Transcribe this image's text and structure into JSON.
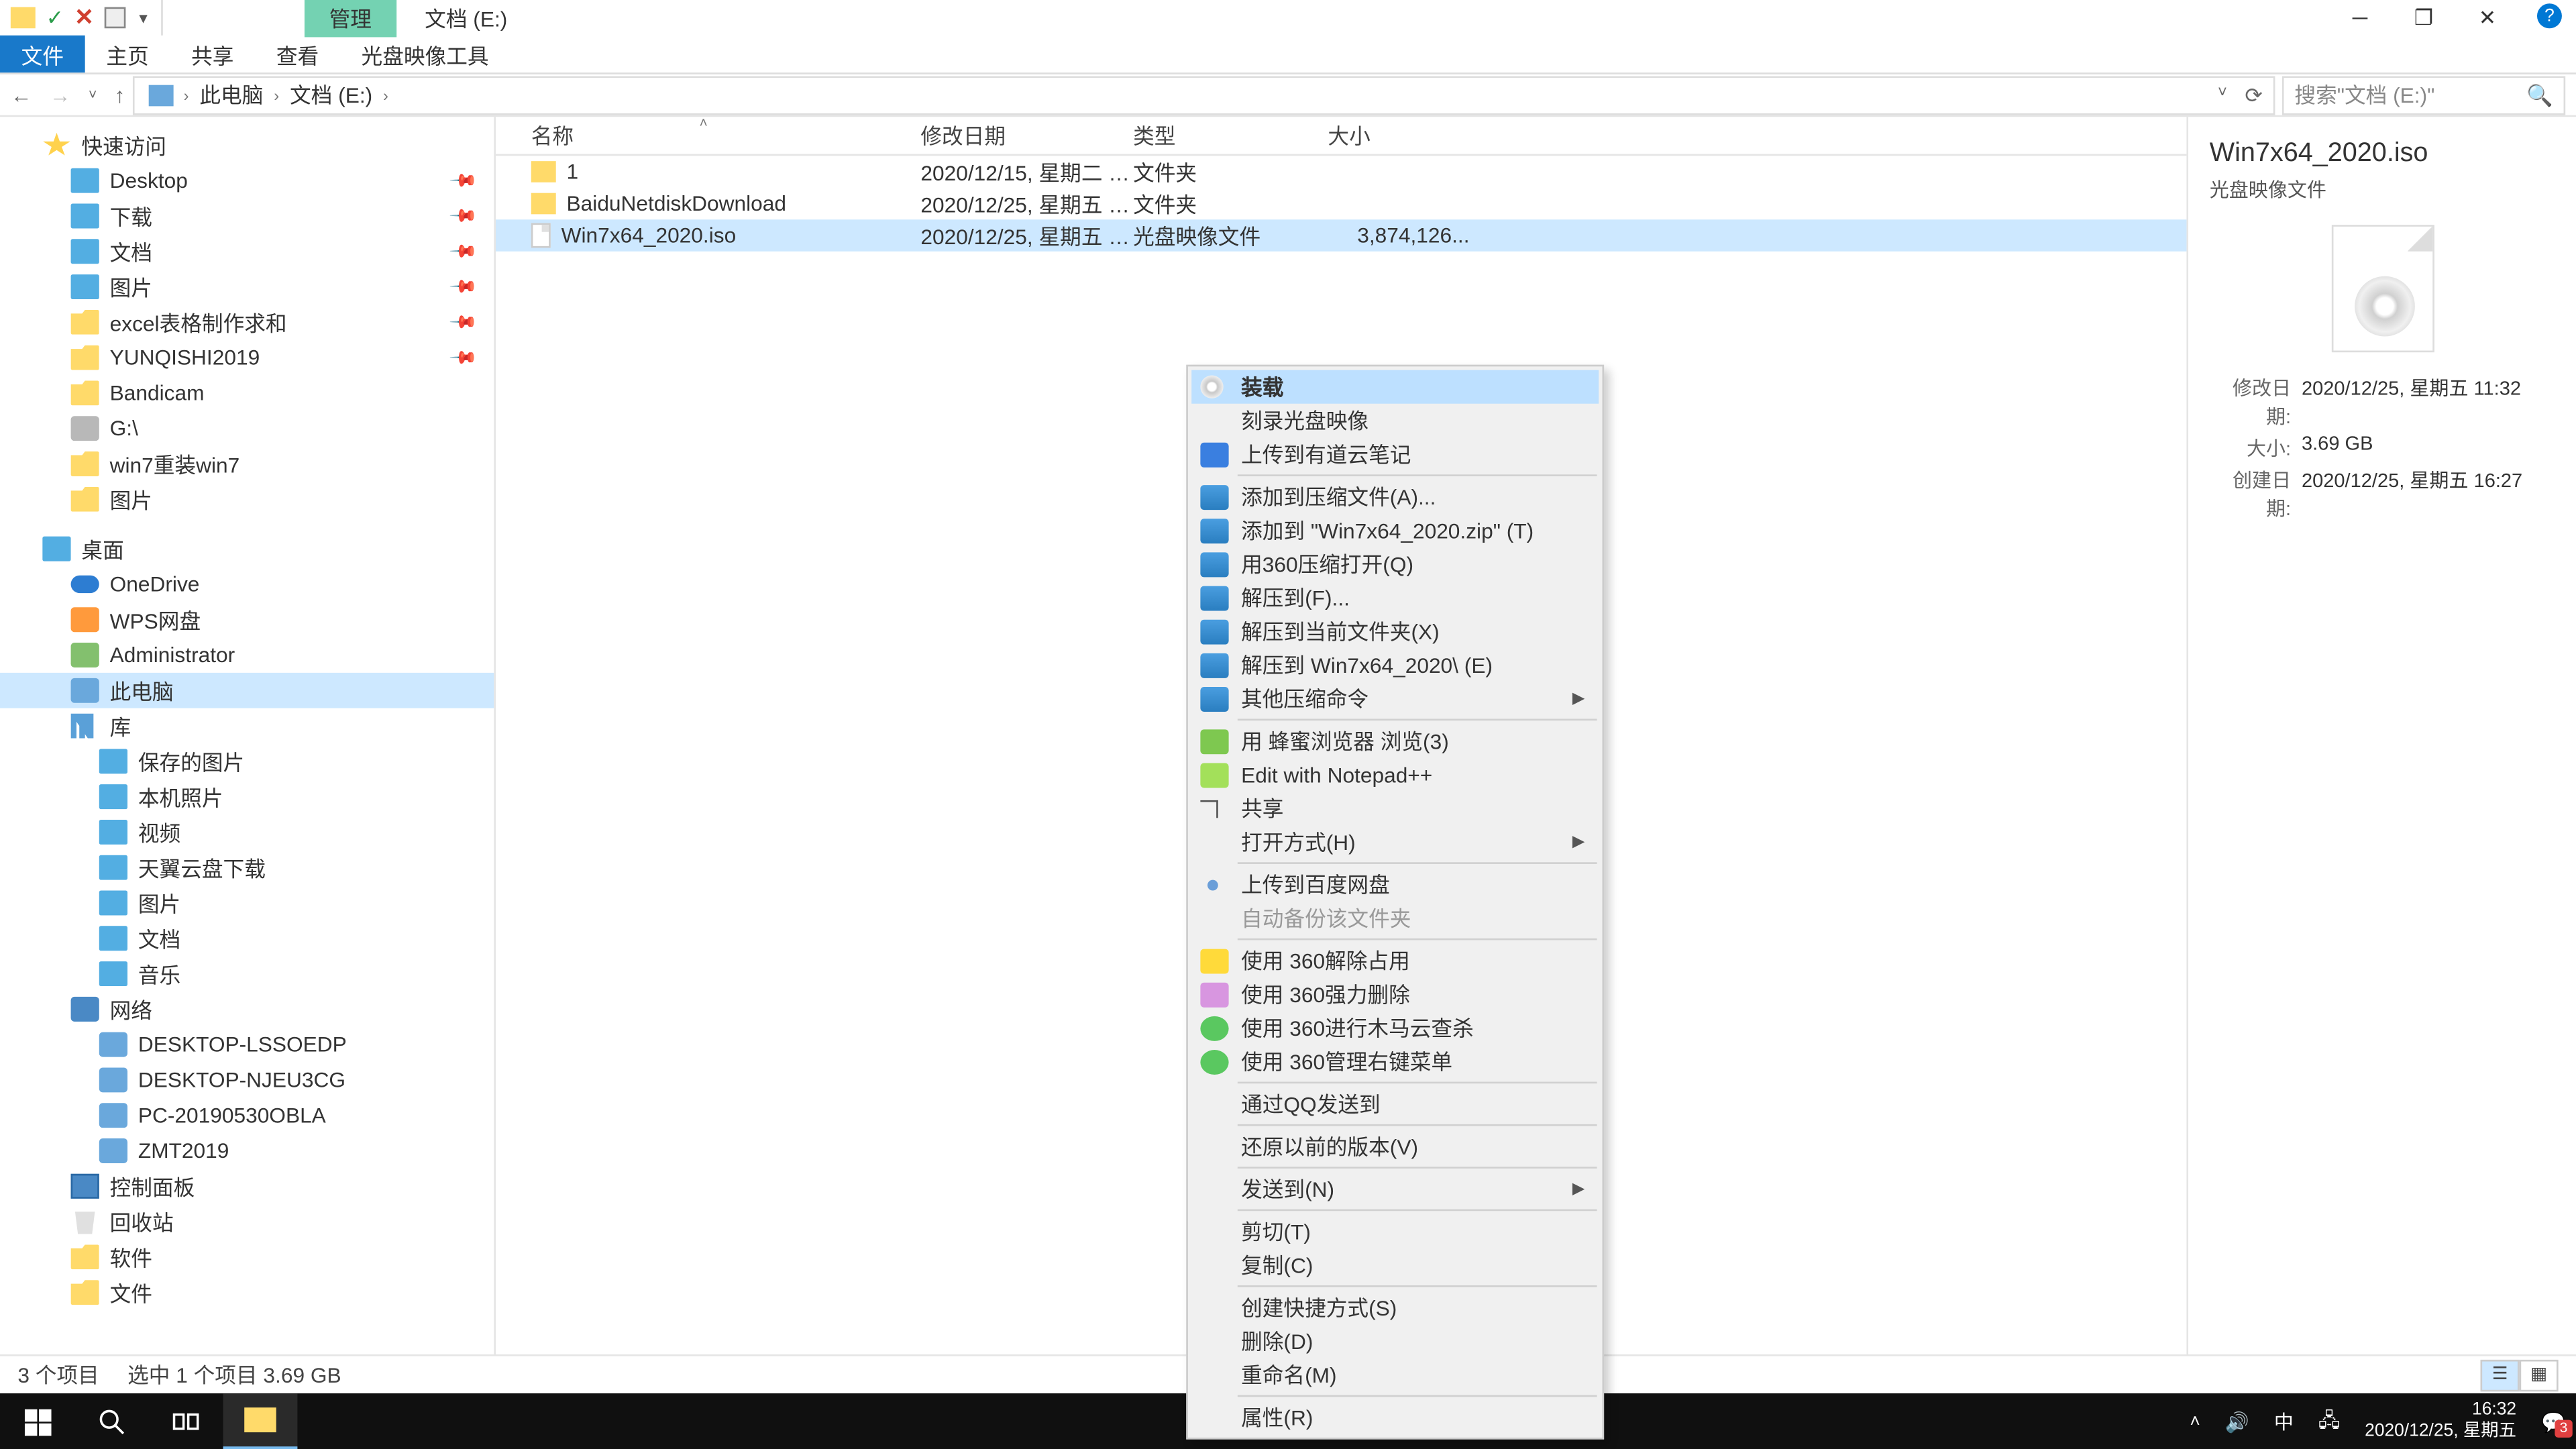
{
  "window": {
    "title": "文档 (E:)",
    "contextual_tab": "管理"
  },
  "ribbon_tabs": [
    "文件",
    "主页",
    "共享",
    "查看",
    "光盘映像工具"
  ],
  "breadcrumbs": [
    "此电脑",
    "文档 (E:)"
  ],
  "search_placeholder": "搜索\"文档 (E:)\"",
  "columns": {
    "name": "名称",
    "date": "修改日期",
    "type": "类型",
    "size": "大小"
  },
  "files": [
    {
      "name": "1",
      "date": "2020/12/15, 星期二 1...",
      "type": "文件夹",
      "size": "",
      "kind": "folder"
    },
    {
      "name": "BaiduNetdiskDownload",
      "date": "2020/12/25, 星期五 1...",
      "type": "文件夹",
      "size": "",
      "kind": "folder"
    },
    {
      "name": "Win7x64_2020.iso",
      "date": "2020/12/25, 星期五 1...",
      "type": "光盘映像文件",
      "size": "3,874,126...",
      "kind": "iso",
      "selected": true
    }
  ],
  "tree": {
    "quick_access": "快速访问",
    "quick_items": [
      {
        "label": "Desktop",
        "icon": "folder-blue",
        "pinned": true
      },
      {
        "label": "下载",
        "icon": "folder-blue",
        "pinned": true
      },
      {
        "label": "文档",
        "icon": "folder-blue",
        "pinned": true
      },
      {
        "label": "图片",
        "icon": "folder-blue",
        "pinned": true
      },
      {
        "label": "excel表格制作求和",
        "icon": "folder",
        "pinned": true
      },
      {
        "label": "YUNQISHI2019",
        "icon": "folder",
        "pinned": true
      },
      {
        "label": "Bandicam",
        "icon": "folder"
      },
      {
        "label": "G:\\",
        "icon": "drive"
      },
      {
        "label": "win7重装win7",
        "icon": "folder"
      },
      {
        "label": "图片",
        "icon": "folder"
      }
    ],
    "desktop": "桌面",
    "desktop_items": [
      {
        "label": "OneDrive",
        "icon": "cloud"
      },
      {
        "label": "WPS网盘",
        "icon": "wps"
      },
      {
        "label": "Administrator",
        "icon": "user"
      },
      {
        "label": "此电脑",
        "icon": "pc",
        "selected": true
      },
      {
        "label": "库",
        "icon": "lib"
      }
    ],
    "lib_items": [
      "保存的图片",
      "本机照片",
      "视频",
      "天翼云盘下载",
      "图片",
      "文档",
      "音乐"
    ],
    "network": "网络",
    "net_items": [
      "DESKTOP-LSSOEDP",
      "DESKTOP-NJEU3CG",
      "PC-20190530OBLA",
      "ZMT2019"
    ],
    "extra": [
      {
        "label": "控制面板",
        "icon": "ctrl"
      },
      {
        "label": "回收站",
        "icon": "bin"
      },
      {
        "label": "软件",
        "icon": "folder"
      },
      {
        "label": "文件",
        "icon": "folder"
      }
    ]
  },
  "context_menu": [
    {
      "label": "装载",
      "icon": "disc",
      "highlighted": true
    },
    {
      "label": "刻录光盘映像"
    },
    {
      "label": "上传到有道云笔记",
      "icon": "note"
    },
    {
      "sep": true
    },
    {
      "label": "添加到压缩文件(A)...",
      "icon": "zip"
    },
    {
      "label": "添加到 \"Win7x64_2020.zip\" (T)",
      "icon": "zip"
    },
    {
      "label": "用360压缩打开(Q)",
      "icon": "zip"
    },
    {
      "label": "解压到(F)...",
      "icon": "zip"
    },
    {
      "label": "解压到当前文件夹(X)",
      "icon": "zip"
    },
    {
      "label": "解压到 Win7x64_2020\\ (E)",
      "icon": "zip"
    },
    {
      "label": "其他压缩命令",
      "icon": "zip",
      "arrow": true
    },
    {
      "sep": true
    },
    {
      "label": "用 蜂蜜浏览器 浏览(3)",
      "icon": "bee"
    },
    {
      "label": "Edit with Notepad++",
      "icon": "npp"
    },
    {
      "label": "共享",
      "icon": "share"
    },
    {
      "label": "打开方式(H)",
      "arrow": true
    },
    {
      "sep": true
    },
    {
      "label": "上传到百度网盘",
      "icon": "baidu"
    },
    {
      "label": "自动备份该文件夹",
      "disabled": true
    },
    {
      "sep": true
    },
    {
      "label": "使用 360解除占用",
      "icon": "360y"
    },
    {
      "label": "使用 360强力删除",
      "icon": "360p"
    },
    {
      "label": "使用 360进行木马云查杀",
      "icon": "360g"
    },
    {
      "label": "使用 360管理右键菜单",
      "icon": "360g"
    },
    {
      "sep": true
    },
    {
      "label": "通过QQ发送到"
    },
    {
      "sep": true
    },
    {
      "label": "还原以前的版本(V)"
    },
    {
      "sep": true
    },
    {
      "label": "发送到(N)",
      "arrow": true
    },
    {
      "sep": true
    },
    {
      "label": "剪切(T)"
    },
    {
      "label": "复制(C)"
    },
    {
      "sep": true
    },
    {
      "label": "创建快捷方式(S)"
    },
    {
      "label": "删除(D)"
    },
    {
      "label": "重命名(M)"
    },
    {
      "sep": true
    },
    {
      "label": "属性(R)"
    }
  ],
  "preview": {
    "title": "Win7x64_2020.iso",
    "subtitle": "光盘映像文件",
    "rows": [
      {
        "label": "修改日期:",
        "value": "2020/12/25, 星期五 11:32"
      },
      {
        "label": "大小:",
        "value": "3.69 GB"
      },
      {
        "label": "创建日期:",
        "value": "2020/12/25, 星期五 16:27"
      }
    ]
  },
  "status": {
    "count": "3 个项目",
    "selection": "选中 1 个项目  3.69 GB"
  },
  "taskbar": {
    "ime": "中",
    "time": "16:32",
    "date": "2020/12/25, 星期五"
  }
}
